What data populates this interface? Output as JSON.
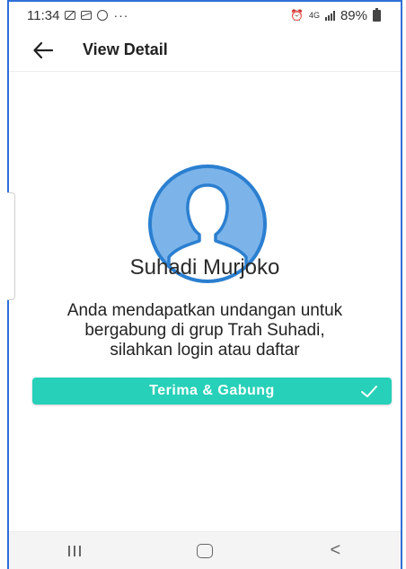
{
  "status_bar": {
    "time": "11:34",
    "dots": "···",
    "network": "4G",
    "battery": "89%"
  },
  "app_bar": {
    "title": "View Detail",
    "back_icon": "arrow-left-icon"
  },
  "profile": {
    "avatar_icon": "user-silhouette-icon",
    "name": "Suhadi Murjoko"
  },
  "invitation": {
    "message": "Anda mendapatkan undangan untuk bergabung di grup Trah Suhadi, silahkan login atau daftar"
  },
  "accept_button": {
    "label": "Terima & Gabung",
    "icon": "check-icon"
  },
  "nav_bar": {
    "recents_icon": "recents-icon",
    "home_icon": "home-icon",
    "back_label": "<"
  },
  "colors": {
    "accent": "#27d0b8",
    "avatar_fill": "#7cb4ea",
    "avatar_stroke": "#2b7fd0",
    "frame_border": "#2f6fd6"
  }
}
